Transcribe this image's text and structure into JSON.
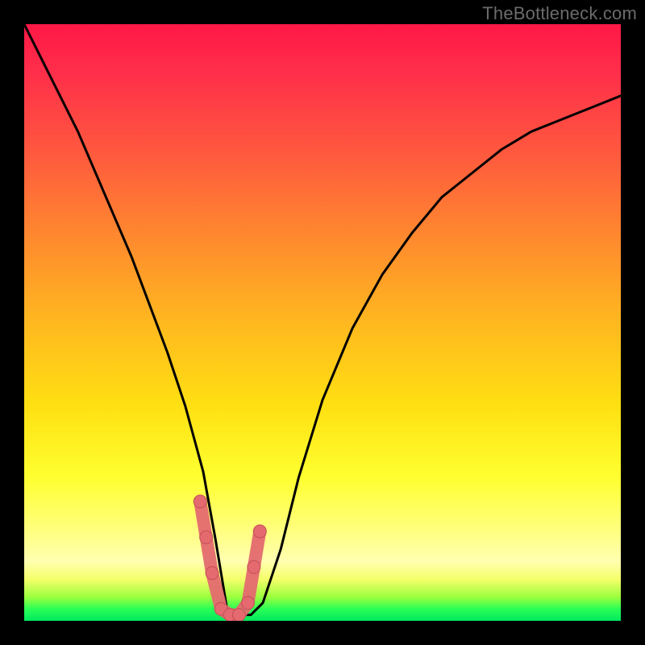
{
  "watermark": "TheBottleneck.com",
  "colors": {
    "page_bg": "#000000",
    "curve_stroke": "#000000",
    "marker_fill": "#e46a6f",
    "marker_stroke": "#c24f55",
    "gradient_stops": [
      "#ff1846",
      "#ff5a3e",
      "#ffb81f",
      "#ffff30",
      "#ffffb0",
      "#00e85e"
    ]
  },
  "chart_data": {
    "type": "line",
    "title": "",
    "xlabel": "",
    "ylabel": "",
    "xlim": [
      0,
      100
    ],
    "ylim": [
      0,
      100
    ],
    "grid": false,
    "legend": false,
    "note": "V-shaped bottleneck curve; y-axis inverted visually (0 at bottom = good/green, 100 at top = bad/red). Minimum near x≈34.",
    "series": [
      {
        "name": "bottleneck-curve",
        "x": [
          0,
          3,
          6,
          9,
          12,
          15,
          18,
          21,
          24,
          27,
          30,
          32,
          34,
          36,
          38,
          40,
          43,
          46,
          50,
          55,
          60,
          65,
          70,
          75,
          80,
          85,
          90,
          95,
          100
        ],
        "y": [
          100,
          94,
          88,
          82,
          75,
          68,
          61,
          53,
          45,
          36,
          25,
          14,
          2,
          1,
          1,
          3,
          12,
          24,
          37,
          49,
          58,
          65,
          71,
          75,
          79,
          82,
          84,
          86,
          88
        ]
      }
    ],
    "markers": {
      "name": "highlight-near-minimum",
      "style": "thick-rounded",
      "x": [
        29.5,
        30.5,
        31.5,
        33,
        34.5,
        36,
        37.5,
        38.5,
        39.5
      ],
      "y": [
        20,
        14,
        8,
        2,
        1,
        1,
        3,
        9,
        15
      ]
    }
  }
}
